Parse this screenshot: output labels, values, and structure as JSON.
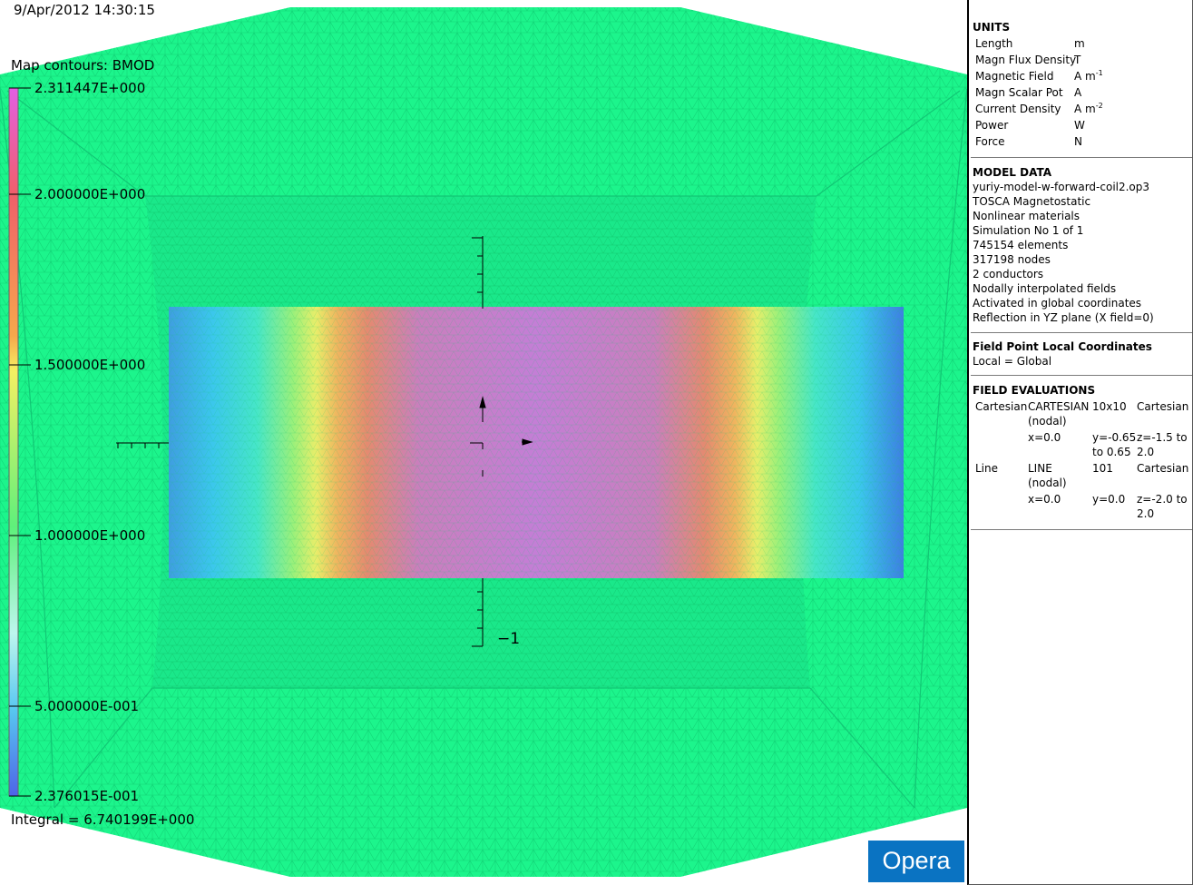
{
  "header": {
    "timestamp": "9/Apr/2012 14:30:15",
    "map_title": "Map contours: BMOD",
    "integral": "Integral = 6.740199E+000"
  },
  "legend": {
    "max_label": "2.311447E+000",
    "min_label": "2.376015E-001",
    "ticks": [
      "2.000000E+000",
      "1.500000E+000",
      "1.000000E+000",
      "5.000000E-001"
    ]
  },
  "axis": {
    "label": "−1"
  },
  "logo": "Opera",
  "colors": {
    "mesh_background": "#1cf58c",
    "logo_blue": "#0a73c2",
    "scale_top": "#e35fe3",
    "scale_bottom": "#4e64e8"
  },
  "units": {
    "title": "UNITS",
    "rows": [
      {
        "key": "Length",
        "value": "m"
      },
      {
        "key": "Magn Flux Density",
        "value": "T"
      },
      {
        "key": "Magnetic Field",
        "value": "A m",
        "sup": "-1"
      },
      {
        "key": "Magn Scalar Pot",
        "value": "A"
      },
      {
        "key": "Current Density",
        "value": "A m",
        "sup": "-2"
      },
      {
        "key": "Power",
        "value": "W"
      },
      {
        "key": "Force",
        "value": "N"
      }
    ]
  },
  "model_data": {
    "title": "MODEL DATA",
    "lines": [
      "yuriy-model-w-forward-coil2.op3",
      "TOSCA Magnetostatic",
      "Nonlinear materials",
      "Simulation No 1 of 1",
      "745154 elements",
      "317198 nodes",
      "2 conductors",
      "Nodally interpolated fields",
      "Activated in global coordinates",
      "Reflection in YZ plane (X field=0)"
    ]
  },
  "field_point": {
    "title": "Field Point Local Coordinates",
    "value": "Local = Global"
  },
  "field_evaluations": {
    "title": "FIELD EVALUATIONS",
    "rows": [
      [
        "Cartesian",
        "CARTESIAN",
        "10x10",
        "Cartesian"
      ],
      [
        "",
        "(nodal)",
        "",
        ""
      ],
      [
        "",
        "x=0.0",
        "y=-0.65",
        "z=-1.5 to"
      ],
      [
        "",
        "",
        "to 0.65",
        "2.0"
      ],
      [
        "Line",
        "LINE",
        "101",
        "Cartesian"
      ],
      [
        "",
        "(nodal)",
        "",
        ""
      ],
      [
        "",
        "x=0.0",
        "y=0.0",
        "z=-2.0 to"
      ],
      [
        "",
        "",
        "",
        "2.0"
      ]
    ]
  }
}
